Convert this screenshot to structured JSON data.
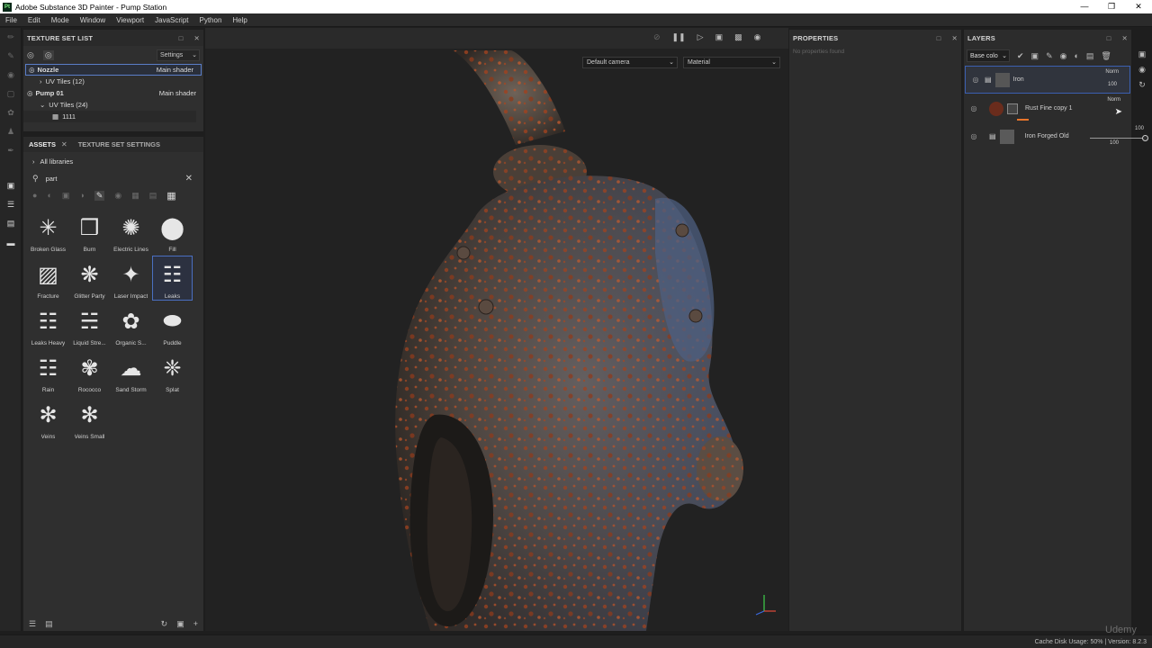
{
  "window": {
    "title": "Adobe Substance 3D Painter - Pump Station",
    "app_icon": "Pt"
  },
  "menu": [
    "File",
    "Edit",
    "Mode",
    "Window",
    "Viewport",
    "JavaScript",
    "Python",
    "Help"
  ],
  "texture_set_list": {
    "title": "TEXTURE SET LIST",
    "settings_label": "Settings",
    "rows": [
      {
        "label": "Nozzle",
        "shader": "Main shader"
      },
      {
        "label": "UV Tiles (12)"
      },
      {
        "label": "Pump 01",
        "shader": "Main shader"
      },
      {
        "label": "UV Tiles (24)"
      },
      {
        "label": "1111"
      }
    ]
  },
  "assets": {
    "tabs": [
      "ASSETS",
      "TEXTURE SET SETTINGS"
    ],
    "library": "All libraries",
    "search_value": "part",
    "items": [
      {
        "label": "Broken Glass"
      },
      {
        "label": "Burn"
      },
      {
        "label": "Electric Lines"
      },
      {
        "label": "Fill"
      },
      {
        "label": "Fracture"
      },
      {
        "label": "Glitter Party"
      },
      {
        "label": "Laser Impact"
      },
      {
        "label": "Leaks"
      },
      {
        "label": "Leaks Heavy"
      },
      {
        "label": "Liquid Stre..."
      },
      {
        "label": "Organic S..."
      },
      {
        "label": "Puddle"
      },
      {
        "label": "Rain"
      },
      {
        "label": "Rococco"
      },
      {
        "label": "Sand Storm"
      },
      {
        "label": "Splat"
      },
      {
        "label": "Veins"
      },
      {
        "label": "Veins Small"
      }
    ]
  },
  "viewport": {
    "camera": "Default camera",
    "mode": "Material"
  },
  "properties": {
    "title": "PROPERTIES",
    "empty": "No properties found"
  },
  "layers": {
    "title": "LAYERS",
    "channel": "Base colo",
    "items": [
      {
        "name": "Iron",
        "blend": "Norm",
        "opacity": "100"
      },
      {
        "name": "Rust Fine copy 1",
        "blend": "Norm",
        "opacity": "100"
      },
      {
        "name": "Iron Forged Old",
        "blend": "",
        "opacity": "100"
      }
    ],
    "slider_value": "100"
  },
  "status": {
    "text": "Cache Disk Usage:   50% | Version: 8.2.3"
  },
  "watermark": "Udemy"
}
